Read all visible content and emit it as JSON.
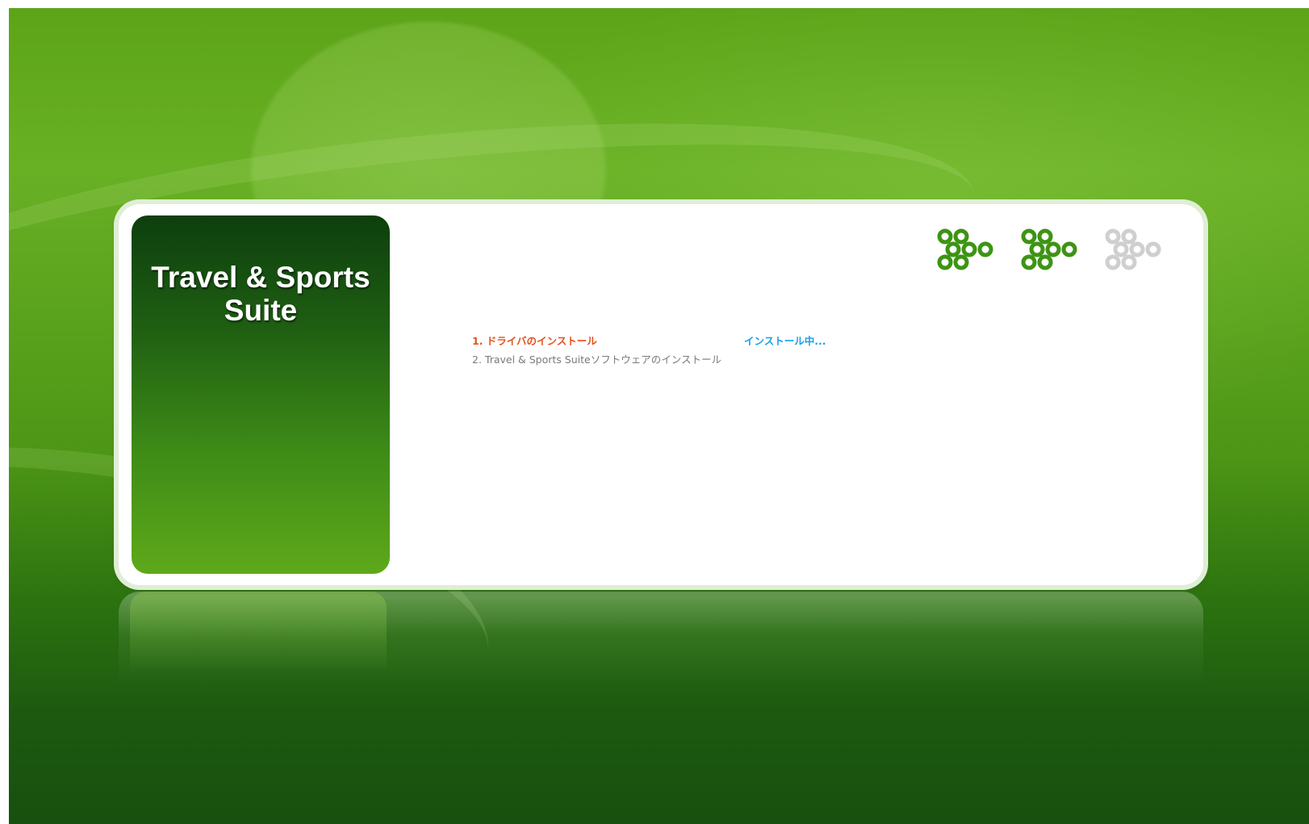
{
  "product": {
    "title_line1": "Travel & Sports",
    "title_line2": "Suite"
  },
  "progress_icons": [
    {
      "name": "step-1-icon",
      "state": "done",
      "color": "#3d9414"
    },
    {
      "name": "step-2-icon",
      "state": "done",
      "color": "#3d9414"
    },
    {
      "name": "step-3-icon",
      "state": "pending",
      "color": "#cfcfcf"
    }
  ],
  "steps": [
    {
      "label": "1. ドライバのインストール",
      "status": "インストール中...",
      "color": "#e2521c"
    },
    {
      "label": "2. Travel & Sports Suiteソフトウェアのインストール",
      "color": "#7a7a7a"
    }
  ],
  "colors": {
    "active_step": "#e2521c",
    "status_text": "#1aa0e8",
    "pending_step": "#7a7a7a",
    "brand_green": "#3d9414"
  }
}
